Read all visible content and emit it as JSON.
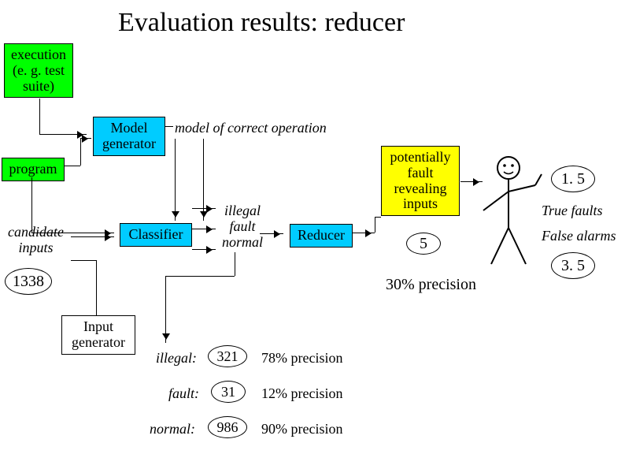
{
  "title": "Evaluation results: reducer",
  "boxes": {
    "execution": "execution\n(e. g. test\nsuite)",
    "program": "program",
    "model_generator": "Model\ngenerator",
    "classifier": "Classifier",
    "reducer": "Reducer",
    "input_generator": "Input\ngenerator",
    "potentially_fault_revealing_inputs": "potentially\nfault\nrevealing\ninputs"
  },
  "labels": {
    "model_of_correct_operation": "model of correct operation",
    "candidate_inputs": "candidate\ninputs",
    "illegal_fault_normal_stack": "illegal\nfault\nnormal",
    "true_faults": "True faults",
    "false_alarms": "False alarms"
  },
  "numbers": {
    "n_1338": "1338",
    "n_5": "5",
    "n_1_5": "1. 5",
    "n_3_5": "3. 5",
    "pct_30": "30% precision"
  },
  "bottom_rows": {
    "illegal_label": "illegal:",
    "illegal_n": "321",
    "illegal_pct": "78% precision",
    "fault_label": "fault:",
    "fault_n": "31",
    "fault_pct": "12% precision",
    "normal_label": "normal:",
    "normal_n": "986",
    "normal_pct": "90% precision"
  },
  "chart_data": {
    "type": "table",
    "title": "Reducer precision and class breakdown",
    "reducer": {
      "input_count": 1338,
      "output_count": 5,
      "precision_pct": 30,
      "true_faults": 1.5,
      "false_alarms": 3.5
    },
    "per_class": [
      {
        "class": "illegal",
        "count": 321,
        "precision_pct": 78
      },
      {
        "class": "fault",
        "count": 31,
        "precision_pct": 12
      },
      {
        "class": "normal",
        "count": 986,
        "precision_pct": 90
      }
    ]
  }
}
